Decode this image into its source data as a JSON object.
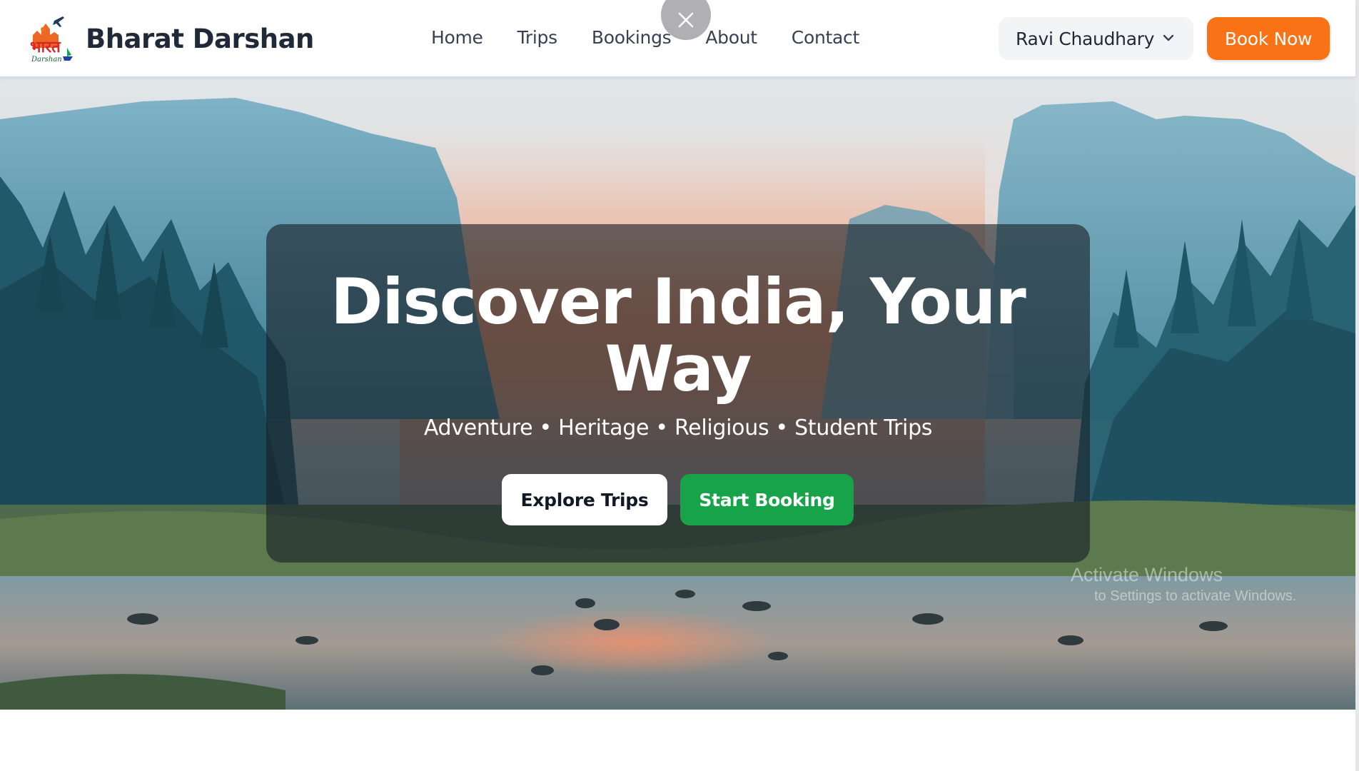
{
  "brand": {
    "name": "Bharat Darshan",
    "logo_icon": "bharat-darshan-logo",
    "logo_text": "भारत",
    "logo_subtext": "Darshan"
  },
  "nav": {
    "items": [
      {
        "label": "Home"
      },
      {
        "label": "Trips"
      },
      {
        "label": "Bookings"
      },
      {
        "label": "About"
      },
      {
        "label": "Contact"
      }
    ]
  },
  "user_menu": {
    "name": "Ravi Chaudhary",
    "icon": "chevron-down-icon"
  },
  "book_now_label": "Book Now",
  "overlay": {
    "close_icon": "close-icon"
  },
  "hero": {
    "title": "Discover India, Your Way",
    "subtitle": "Adventure • Heritage • Religious • Student Trips",
    "explore_label": "Explore Trips",
    "booking_label": "Start Booking"
  },
  "watermark": {
    "line1": "Activate Windows",
    "line2": "to Settings to activate Windows."
  },
  "colors": {
    "accent": "#f97316",
    "success": "#16a34a",
    "text_dark": "#1f2937"
  }
}
